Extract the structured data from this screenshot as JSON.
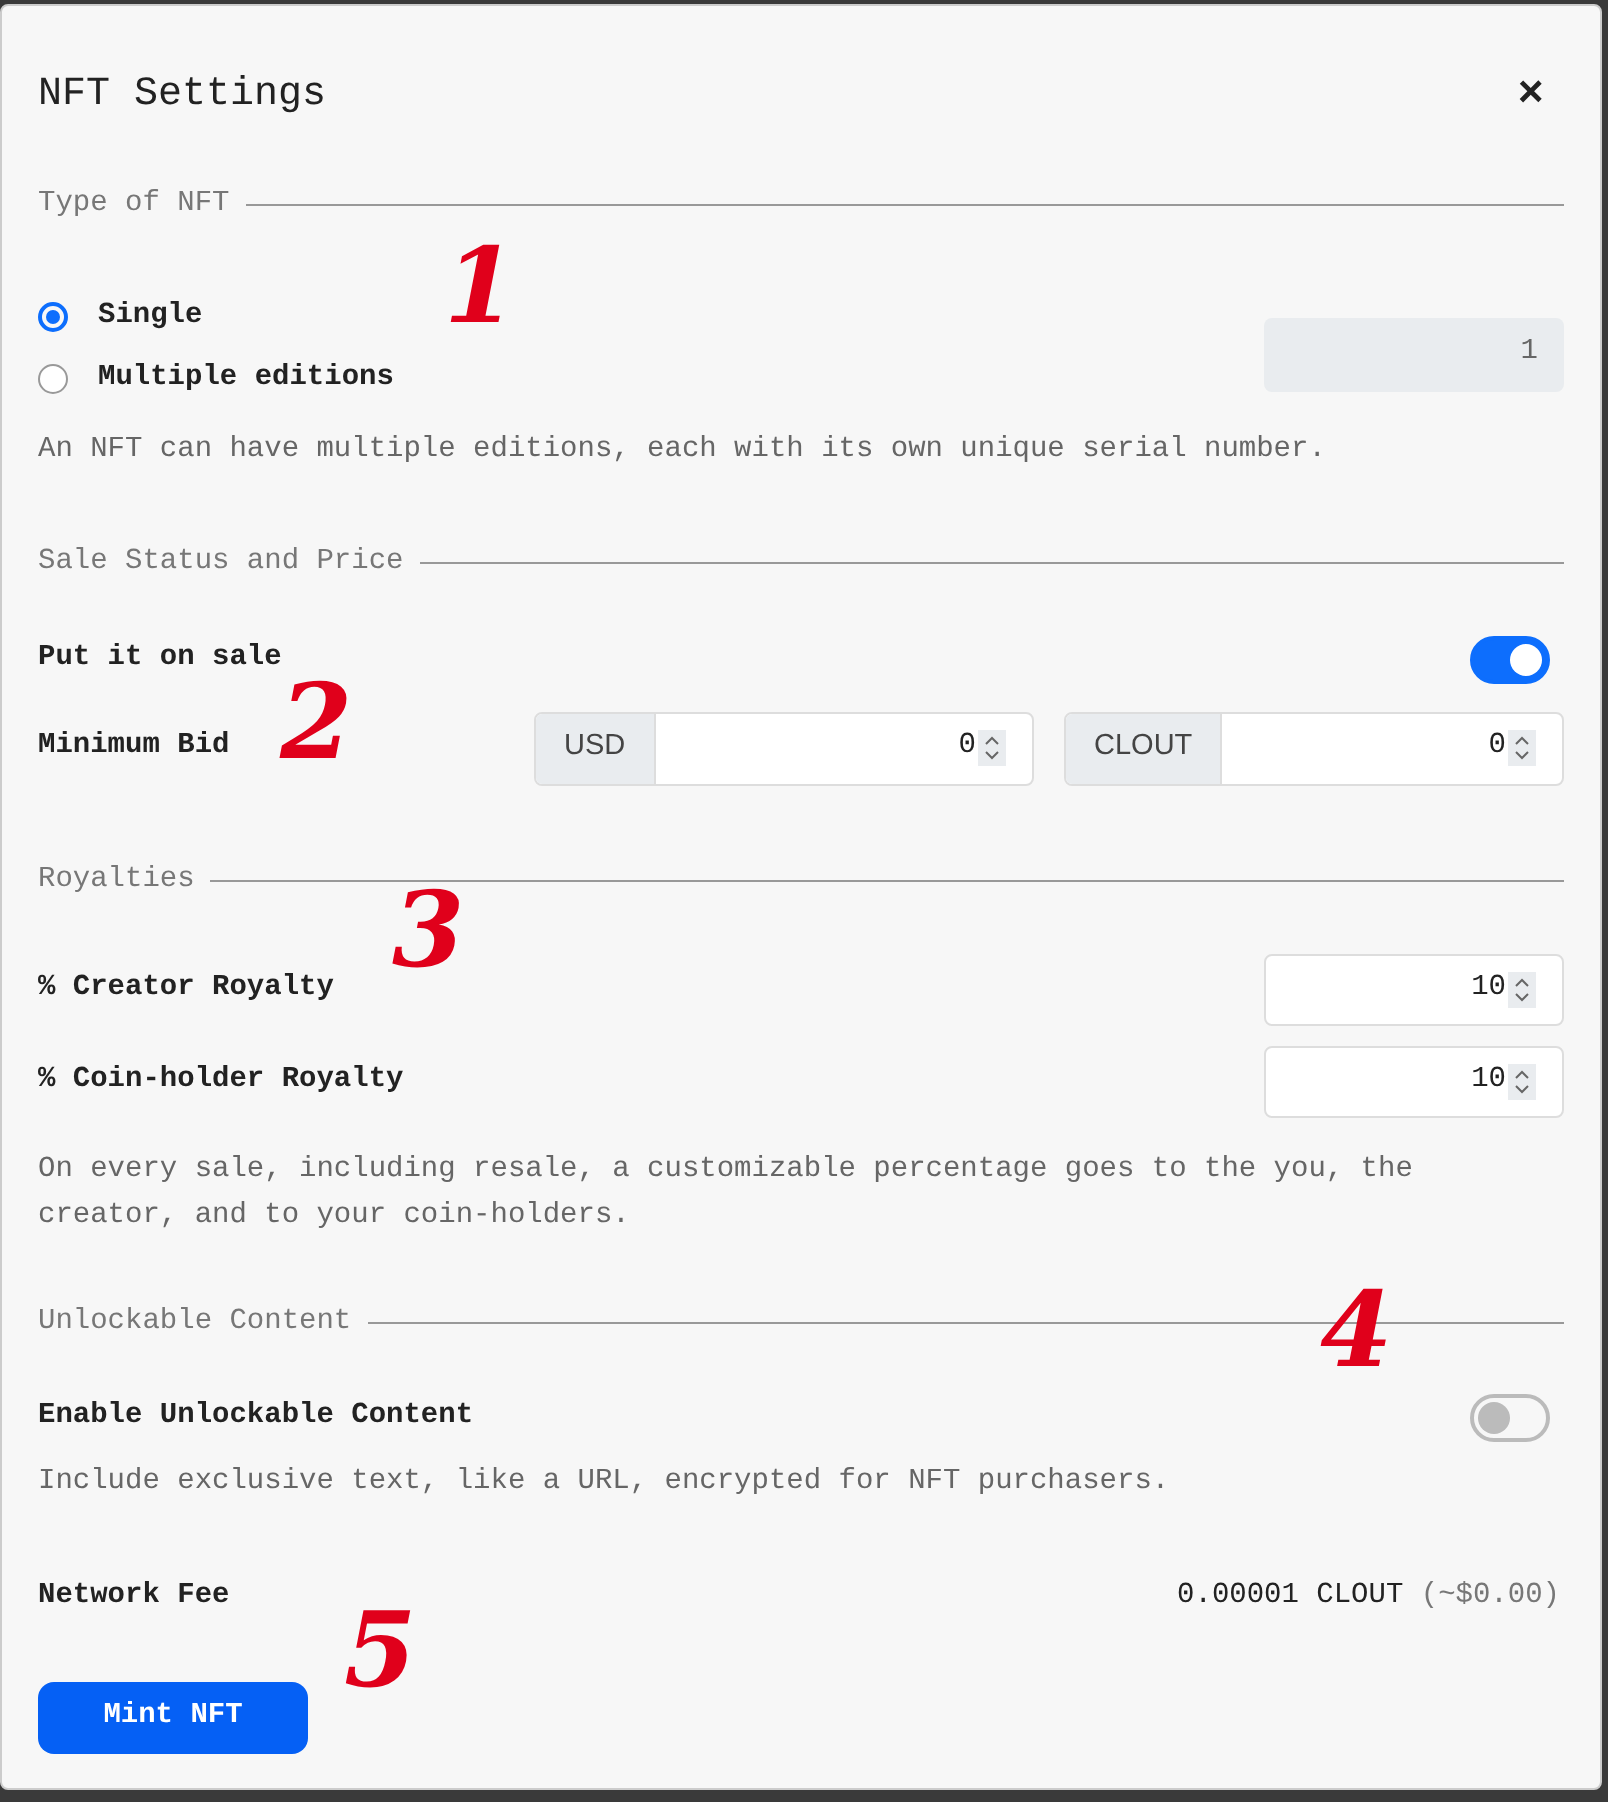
{
  "dialog": {
    "title": "NFT Settings",
    "close": "×"
  },
  "type_section": {
    "heading": "Type of NFT",
    "options": [
      {
        "label": "Single",
        "selected": true
      },
      {
        "label": "Multiple editions",
        "selected": false
      }
    ],
    "editions_value": "1",
    "editions_disabled": true,
    "help": "An NFT can have multiple editions, each with its own unique serial number."
  },
  "sale_section": {
    "heading": "Sale Status and Price",
    "on_sale_label": "Put it on sale",
    "on_sale": true,
    "min_bid_label": "Minimum Bid",
    "bids": [
      {
        "currency": "USD",
        "value": "0"
      },
      {
        "currency": "CLOUT",
        "value": "0"
      }
    ]
  },
  "royalties_section": {
    "heading": "Royalties",
    "fields": [
      {
        "label": "% Creator Royalty",
        "value": "10"
      },
      {
        "label": "% Coin-holder Royalty",
        "value": "10"
      }
    ],
    "help": "On every sale, including resale, a customizable percentage goes to the you, the creator, and to your coin-holders."
  },
  "unlockable_section": {
    "heading": "Unlockable Content",
    "label": "Enable Unlockable Content",
    "on": false,
    "help": "Include exclusive text, like a URL, encrypted for NFT purchasers."
  },
  "fee": {
    "label": "Network Fee",
    "amount": "0.00001 CLOUT",
    "approx": "(~$0.00)"
  },
  "mint_button": "Mint NFT",
  "annotations": [
    "1",
    "2",
    "3",
    "4",
    "5"
  ]
}
